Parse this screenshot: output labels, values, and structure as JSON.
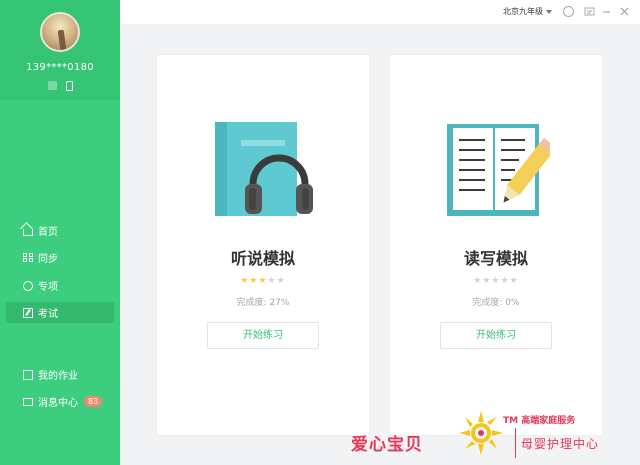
{
  "profile": {
    "phone": "139****0180"
  },
  "nav": {
    "items": [
      {
        "label": "首页",
        "icon": "home-icon"
      },
      {
        "label": "同步",
        "icon": "grid-icon"
      },
      {
        "label": "专项",
        "icon": "target-icon"
      },
      {
        "label": "考试",
        "icon": "exam-icon",
        "active": true
      }
    ],
    "secondary": [
      {
        "label": "我的作业",
        "icon": "homework-icon"
      },
      {
        "label": "消息中心",
        "icon": "message-icon",
        "badge": "83"
      }
    ]
  },
  "topbar": {
    "region": "北京九年级"
  },
  "cards": [
    {
      "title": "听说模拟",
      "stars_filled": 3,
      "stars_total": 5,
      "progress_text": "完成度: 27%",
      "button": "开始练习",
      "illustration": "headphones-book-icon"
    },
    {
      "title": "读写模拟",
      "stars_filled": 0,
      "stars_total": 5,
      "progress_text": "完成度: 0%",
      "button": "开始练习",
      "illustration": "open-book-pencil-icon"
    }
  ],
  "brand": {
    "name": "爱心宝贝",
    "tm": "TM 高端家庭服务",
    "sub": "母婴护理中心"
  },
  "colors": {
    "sidebar": "#3dcd7e",
    "accent": "#37c277",
    "star_on": "#f5cd45",
    "brand": "#e6385a"
  }
}
